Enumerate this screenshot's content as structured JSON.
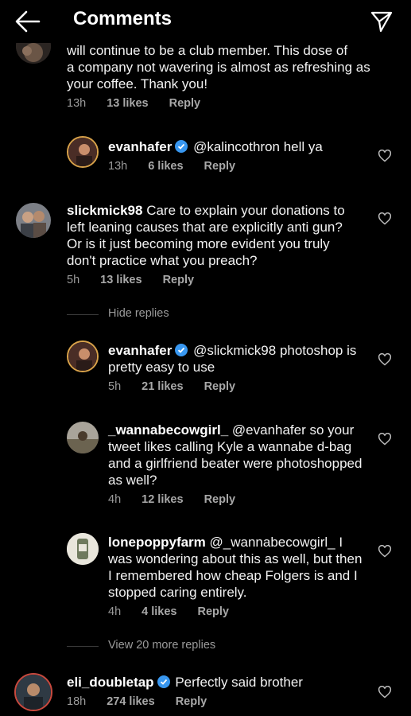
{
  "header": {
    "title": "Comments"
  },
  "comments": [
    {
      "username": "",
      "text_prefix": "will continue to be a club member.  This dose of",
      "text": "a company not wavering is almost as refreshing as your coffee. Thank you!",
      "time": "13h",
      "likes": "13 likes",
      "reply": "Reply"
    },
    {
      "username": "evanhafer",
      "verified": true,
      "text": "@kalincothron hell ya",
      "time": "13h",
      "likes": "6 likes",
      "reply": "Reply"
    },
    {
      "username": "slickmick98",
      "text": "Care to explain your donations to left leaning causes that are explicitly anti gun? Or is it just becoming more evident you truly don't practice what you preach?",
      "time": "5h",
      "likes": "13 likes",
      "reply": "Reply"
    },
    {
      "username": "evanhafer",
      "verified": true,
      "text": "@slickmick98 photoshop is pretty easy to use",
      "time": "5h",
      "likes": "21 likes",
      "reply": "Reply"
    },
    {
      "username": "_wannabecowgirl_",
      "text": "@evanhafer so your tweet likes calling Kyle a wannabe d-bag and a girlfriend beater were photoshopped as well?",
      "time": "4h",
      "likes": "12 likes",
      "reply": "Reply"
    },
    {
      "username": "lonepoppyfarm",
      "text": "@_wannabecowgirl_ I was wondering about this as well, but then I remembered how cheap Folgers is and I stopped caring entirely.",
      "time": "4h",
      "likes": "4 likes",
      "reply": "Reply"
    },
    {
      "username": "eli_doubletap",
      "verified": true,
      "text": "Perfectly said brother",
      "time": "18h",
      "likes": "274 likes",
      "reply": "Reply"
    }
  ],
  "thread_controls": {
    "hide_replies": "Hide replies",
    "view_more": "View 20 more replies"
  },
  "colors": {
    "background": "#000000",
    "verified": "#3897f0",
    "muted": "#9b9b9b"
  },
  "icons": [
    "back-arrow-icon",
    "send-icon",
    "verified-badge-icon",
    "heart-icon"
  ]
}
